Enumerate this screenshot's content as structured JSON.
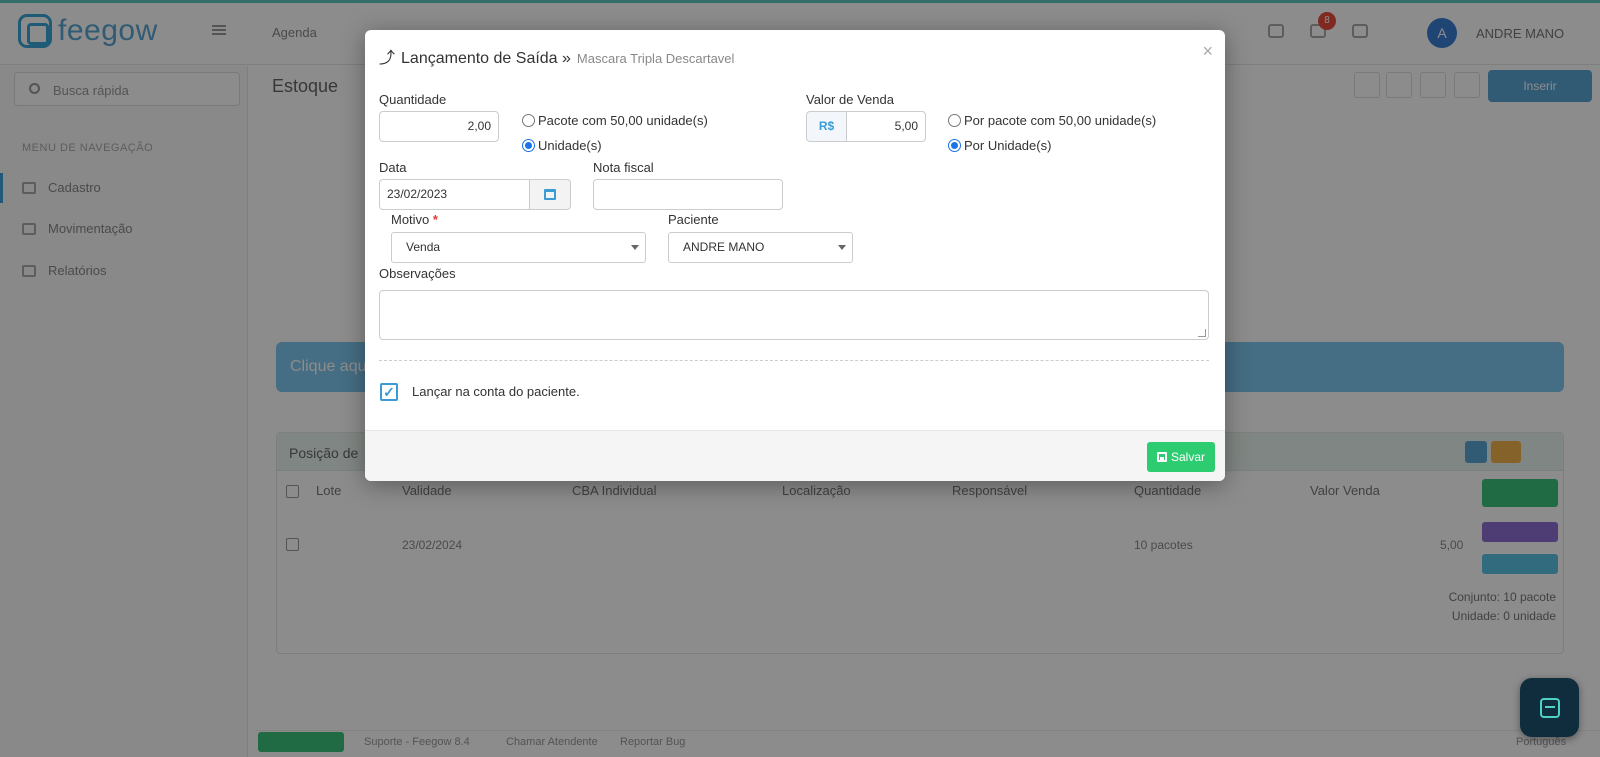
{
  "app": {
    "brand": "feegow",
    "top_menu_item": "Agenda",
    "user_name": "ANDRE MANO",
    "user_initial": "A",
    "notification_count": "8"
  },
  "sidebar": {
    "search_placeholder": "Busca rápida",
    "section_label": "MENU DE NAVEGAÇÃO",
    "items": [
      {
        "label": "Cadastro"
      },
      {
        "label": "Movimentação"
      },
      {
        "label": "Relatórios"
      }
    ]
  },
  "page": {
    "title": "Estoque",
    "top_button": "Inserir",
    "banner_text": "Clique aqui",
    "panel_title": "Posição de",
    "table_headers": [
      "Lote",
      "Validade",
      "CBA Individual",
      "Localização",
      "Responsável",
      "Quantidade",
      "Valor Venda"
    ],
    "row": {
      "validade": "23/02/2024",
      "quantidade": "10 pacotes",
      "valor": "5,00"
    },
    "summary_line1": "Conjunto: 10 pacote",
    "summary_line2": "Unidade: 0 unidade"
  },
  "footer": {
    "items": [
      "Suporte - Feegow 8.4",
      "Chamar Atendente",
      "Reportar Bug"
    ],
    "right_label": "Português"
  },
  "modal": {
    "title": "Lançamento de Saída »",
    "subtitle": "Mascara Tripla Descartavel",
    "close": "×",
    "quantidade": {
      "label": "Quantidade",
      "value": "2,00",
      "options": [
        "Pacote com 50,00 unidade(s)",
        "Unidade(s)"
      ],
      "selected": "Unidade(s)"
    },
    "valor_venda": {
      "label": "Valor de Venda",
      "currency": "R$",
      "value": "5,00",
      "options": [
        "Por pacote com 50,00 unidade(s)",
        "Por Unidade(s)"
      ],
      "selected": "Por Unidade(s)"
    },
    "data": {
      "label": "Data",
      "value": "23/02/2023",
      "icon": "calendar-icon"
    },
    "nota_fiscal": {
      "label": "Nota fiscal",
      "value": ""
    },
    "motivo": {
      "label": "Motivo",
      "required": "*",
      "value": "Venda"
    },
    "paciente": {
      "label": "Paciente",
      "value": "ANDRE MANO"
    },
    "observacoes": {
      "label": "Observações",
      "value": ""
    },
    "lancar_conta": {
      "label": "Lançar na conta do paciente.",
      "checked": true
    },
    "save_label": "Salvar"
  },
  "colors": {
    "accent": "#3a9bd5",
    "save_green": "#2ecc71",
    "required_red": "#e53935",
    "overlay": "rgba(0,0,0,0.45)"
  }
}
